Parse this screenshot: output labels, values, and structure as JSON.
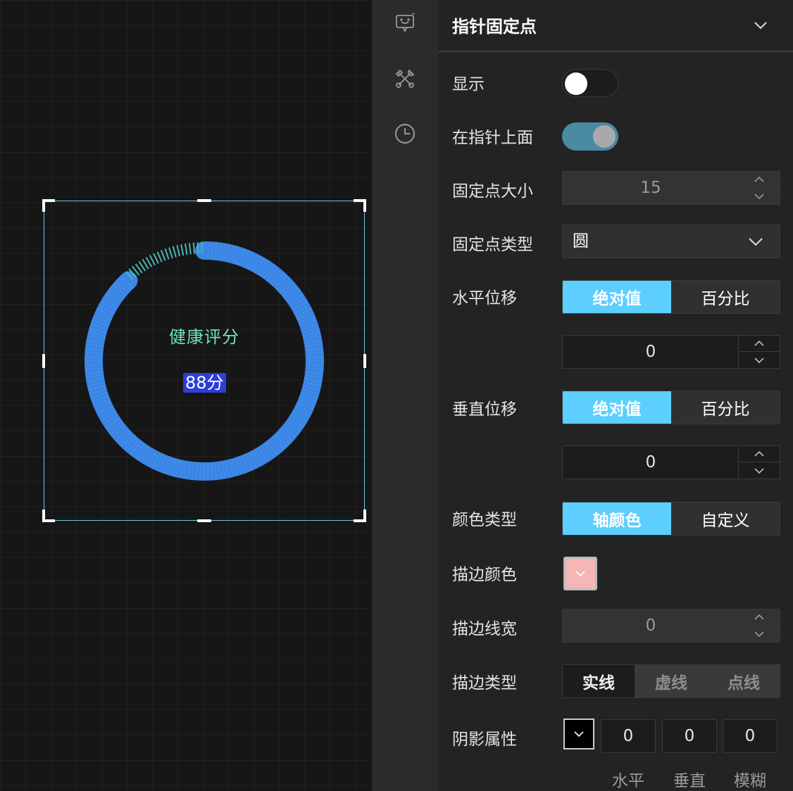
{
  "gauge": {
    "title": "健康评分",
    "value_text": "88分",
    "percent": 88,
    "ring_color": "#3a86e6",
    "tick_color": "#4ab5b5"
  },
  "rail": {
    "icons": [
      "chat-bubble-icon",
      "tools-icon",
      "history-clock-icon"
    ]
  },
  "panel": {
    "title": "指针固定点",
    "show": {
      "label": "显示",
      "on": false
    },
    "above_pointer": {
      "label": "在指针上面",
      "on": true
    },
    "size": {
      "label": "固定点大小",
      "value": "15"
    },
    "type": {
      "label": "固定点类型",
      "value": "圆"
    },
    "h_offset": {
      "label": "水平位移",
      "options": [
        "绝对值",
        "百分比"
      ],
      "active": 0,
      "value": "0"
    },
    "v_offset": {
      "label": "垂直位移",
      "options": [
        "绝对值",
        "百分比"
      ],
      "active": 0,
      "value": "0"
    },
    "color_type": {
      "label": "颜色类型",
      "options": [
        "轴颜色",
        "自定义"
      ],
      "active": 0
    },
    "stroke_color": {
      "label": "描边颜色",
      "color": "#f4b6b6"
    },
    "stroke_width": {
      "label": "描边线宽",
      "value": "0"
    },
    "stroke_type": {
      "label": "描边类型",
      "options": [
        "实线",
        "虚线",
        "点线"
      ],
      "active": 0
    },
    "shadow": {
      "label": "阴影属性",
      "color": "#000000",
      "values": [
        "0",
        "0",
        "0"
      ],
      "captions": [
        "水平",
        "垂直",
        "模糊"
      ]
    }
  }
}
